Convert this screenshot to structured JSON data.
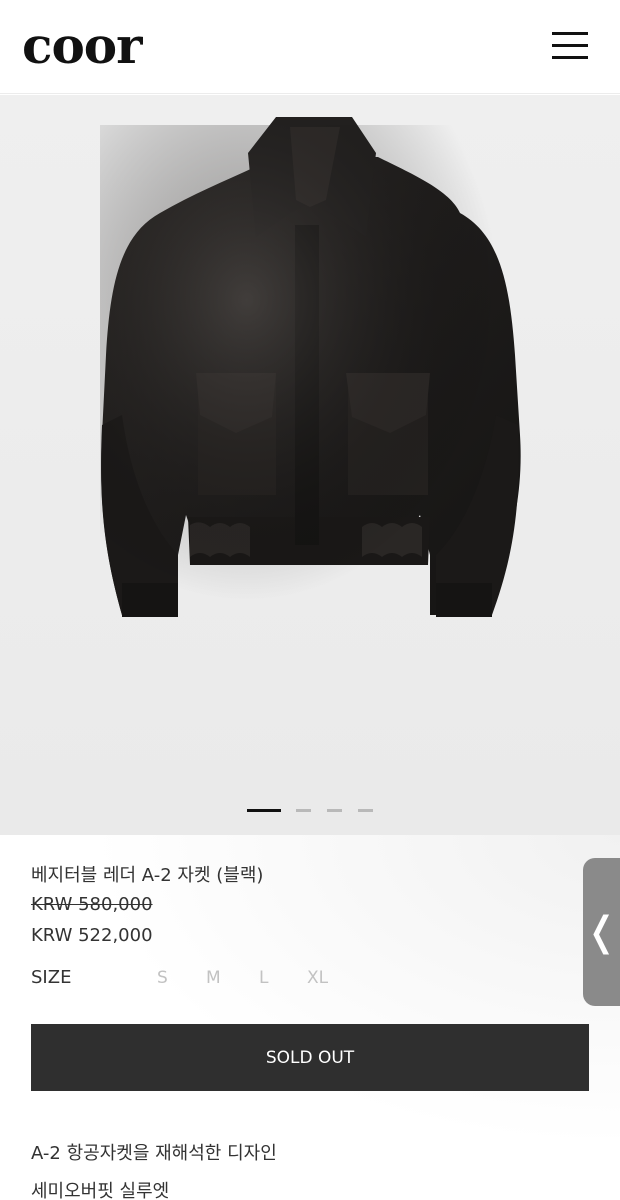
{
  "header": {
    "logo": "coor",
    "menu_icon": "hamburger-menu-icon"
  },
  "gallery": {
    "slide_count": 4,
    "active_index": 0
  },
  "product": {
    "name": "베지터블 레더 A-2 자켓 (블랙)",
    "original_price": "KRW 580,000",
    "sale_price": "KRW 522,000"
  },
  "size": {
    "label": "SIZE",
    "options": [
      "S",
      "M",
      "L",
      "XL"
    ]
  },
  "cta": {
    "label": "SOLD OUT"
  },
  "description": [
    "A-2 항공자켓을 재해석한 디자인",
    "세미오버핏 실루엣"
  ],
  "side_tab": {
    "icon": "chevron-left-icon",
    "glyph": "❬"
  }
}
